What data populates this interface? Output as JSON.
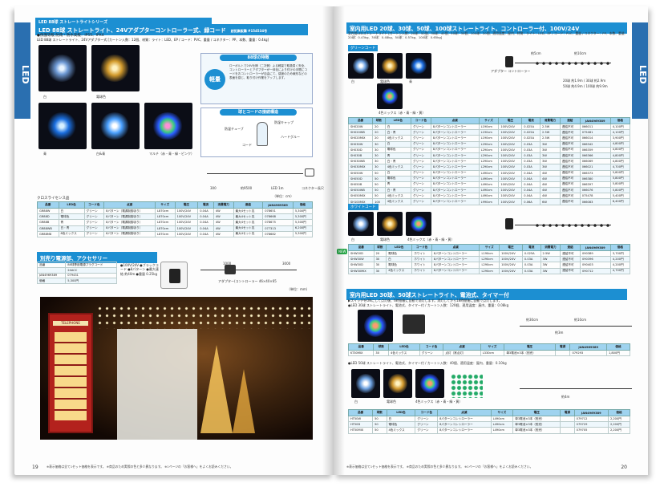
{
  "left": {
    "page_number": "19",
    "side_tab": "LED",
    "series": "LED 88球 ストレートライトシリーズ",
    "title": "LED 88球 ストレートライト、24Vアダプターコントローラー式、緑コード",
    "code_ref": "創拓集販購 #154534号",
    "spec_line": "LED 88球 ストレートライト、24Vアダプター式 [カートン入数：12個、材質：ライト：LED、EP / コード：PVC、重量 / コネクター：PP、本数、重量：0.4kg]",
    "spec_line2": "●保護等級 防雨・防水高級：IP55、IPX4",
    "photo_captions": [
      "白",
      "電球色",
      "青",
      "白&青",
      "マルチ（赤・青・緑・ピンク）"
    ],
    "feature_title": "88球の特徴",
    "feature_badge": "軽量",
    "feature_text": "ローボルトで24V仕様（二次側）よる軽量で取扱易く安全、コントローラーとアダプターが一体化により付けの手間にコードをおコントローラーが自由にて、感度のため線形などの表面を感じ、取り付け作業をアップします。",
    "diagram_title": "球とコードの接続構造",
    "diagram_labels": [
      "防湿キャップ",
      "防湿チューブ",
      "コード",
      "ハードグルー"
    ],
    "dim_labels": [
      "300",
      "約9500",
      "LED 1m",
      "コネクター長尺"
    ],
    "dim_unit": "（単位：cm）",
    "table1_title": "クロスライセンス品",
    "table1_head": [
      "品番",
      "LED色",
      "コード色",
      "点滅",
      "サイズ",
      "電圧",
      "電流",
      "消費電力",
      "連結",
      "JAN4969389",
      "価格"
    ],
    "table1_rows": [
      [
        "GR88W",
        "白",
        "グリーン",
        "8パターン（電源制御あり）",
        "L870cm",
        "100V/24V",
        "0.04A",
        "4W",
        "最大4セット迄",
        "078651",
        "5,300円"
      ],
      [
        "GR88D",
        "電球色",
        "グリーン",
        "8パターン（電源制御あり）",
        "L870cm",
        "100V/24V",
        "0.04A",
        "4W",
        "最大4セット迄",
        "078668",
        "5,300円"
      ],
      [
        "GR88B",
        "青",
        "グリーン",
        "8パターン（電源制御あり）",
        "L870cm",
        "100V/24V",
        "0.04A",
        "4W",
        "最大4セット迄",
        "078675",
        "5,300円"
      ],
      [
        "GR88WB",
        "白・青",
        "グリーン",
        "8パターン（電源制御あり）",
        "L870cm",
        "100V/24V",
        "0.04A",
        "4W",
        "最大4セット迄",
        "077313",
        "6,200円"
      ],
      [
        "GR88M8",
        "8色ミックス",
        "グリーン",
        "8パターン（電源制御あり）",
        "L870cm",
        "100V/24V",
        "0.04A",
        "4W",
        "最大4セット迄",
        "078682",
        "5,300円"
      ]
    ],
    "acc_title": "別売り電源部、アクセサリー",
    "acc_rows": [
      [
        "品番",
        "88球専用電源プラグコード"
      ],
      [
        "",
        "24ACC"
      ],
      [
        "JAN4969389",
        "079431"
      ],
      [
        "価格",
        "5,300円"
      ]
    ],
    "acc_specs": "●100V/24V ●ブラックコード ●8パターン ●最大連結 約40m ●重量 0.25kg",
    "adapter_label": "アダプター(コントローラー 46×40×65",
    "acc_unit": "（単位：mm）",
    "acc_dims": [
      "1000",
      "3000"
    ],
    "photo_label": "TELEPHONE",
    "footer": "※表示価格は全て1セット価格を表示です。 ※商品のため実際の色と多少異なります。 ※1ページの「お客様へ」をよくお読みください。"
  },
  "right": {
    "page_number": "20",
    "side_tab": "LED",
    "title": "室内用LED 20球、30球、50球、100球ストレートライト、コントローラー付、100V/24V",
    "spec_line": "室内用LEDストレートライト [カートン入数：20球：50個、30球：40個、50球：30個、100球：20個、適用温度：屋内、材質：ライト：LED、EP / コード：PVC、重量 / コネクター：PP、本数、重量：20球：0.43kg、30球：0.48kg、50球：0.57kg、100球：0.65kg]",
    "green_label": "グリーンコード",
    "white_label": "ホワイトコード",
    "controller_label": "アダプター コントローラー",
    "length_labels": [
      "約5cm",
      "約10cm"
    ],
    "len_notes": [
      "20球 約1.9m / 30球 約2.9m",
      "50球 約4.9m / 100球 約9.9m"
    ],
    "green_captions": [
      "白",
      "電球色",
      "青",
      "4色ミックス（赤・青・緑・黄）"
    ],
    "table_head": [
      "品番",
      "球数",
      "LED色",
      "コード色",
      "点滅",
      "サイズ",
      "電圧",
      "電流",
      "消費電力",
      "連結",
      "JAN4969389",
      "価格"
    ],
    "green_rows": [
      [
        "SH020W",
        "20",
        "白",
        "グリーン",
        "8パターンコントローラー",
        "L190cm",
        "100V/24V",
        "0.025A",
        "2.5W",
        "連結不可",
        "066011",
        "4,100円"
      ],
      [
        "SH020WB",
        "20",
        "白・青",
        "グリーン",
        "8パターンコントローラー",
        "L190cm",
        "100V/24V",
        "0.025A",
        "2.5W",
        "連結不可",
        "075481",
        "4,100円"
      ],
      [
        "SH020MIX",
        "20",
        "4色ミックス",
        "グリーン",
        "8パターンコントローラー",
        "L190cm",
        "100V/24V",
        "0.025A",
        "2.5W",
        "連結不可",
        "066014",
        "3,900円"
      ],
      [
        "SH030W",
        "30",
        "白",
        "グリーン",
        "8パターンコントローラー",
        "L290cm",
        "100V/24V",
        "0.03A",
        "3W",
        "連結不可",
        "066342",
        "4,800円"
      ],
      [
        "SH030D",
        "30",
        "電球色",
        "グリーン",
        "8パターンコントローラー",
        "L290cm",
        "100V/24V",
        "0.03A",
        "3W",
        "連結不可",
        "066359",
        "4,800円"
      ],
      [
        "SH030B",
        "30",
        "青",
        "グリーン",
        "8パターンコントローラー",
        "L290cm",
        "100V/24V",
        "0.03A",
        "3W",
        "連結不可",
        "066366",
        "4,800円"
      ],
      [
        "SH030WB",
        "30",
        "白・青",
        "グリーン",
        "8パターンコントローラー",
        "L290cm",
        "100V/24V",
        "0.03A",
        "3W",
        "連結不可",
        "066069",
        "4,800円"
      ],
      [
        "SH030MIX",
        "30",
        "4色ミックス",
        "グリーン",
        "8パターンコントローラー",
        "L290cm",
        "100V/24V",
        "0.03A",
        "3W",
        "連結不可",
        "066021",
        "4,700円"
      ],
      [
        "SH050W",
        "50",
        "白",
        "グリーン",
        "8パターンコントローラー",
        "L490cm",
        "100V/24V",
        "0.04A",
        "4W",
        "連結不可",
        "066373",
        "5,800円"
      ],
      [
        "SH050D",
        "50",
        "電球色",
        "グリーン",
        "8パターンコントローラー",
        "L490cm",
        "100V/24V",
        "0.04A",
        "4W",
        "連結不可",
        "066380",
        "5,800円"
      ],
      [
        "SH050B",
        "50",
        "青",
        "グリーン",
        "8パターンコントローラー",
        "L490cm",
        "100V/24V",
        "0.04A",
        "4W",
        "連結不可",
        "066397",
        "5,800円"
      ],
      [
        "SH050WB",
        "50",
        "白・青",
        "グリーン",
        "8パターンコントローラー",
        "L490cm",
        "100V/24V",
        "0.04A",
        "4W",
        "連結不可",
        "066076",
        "5,800円"
      ],
      [
        "SH050MIX",
        "50",
        "4色ミックス",
        "グリーン",
        "8パターンコントローラー",
        "L490cm",
        "100V/24V",
        "0.04A",
        "4W",
        "連結不可",
        "075478",
        "5,400円"
      ],
      [
        "SH100MIX",
        "100",
        "4色ミックス",
        "グリーン",
        "8パターンコントローラー",
        "L990cm",
        "100V/24V",
        "0.06A",
        "6W",
        "連結不可",
        "066083",
        "8,400円"
      ]
    ],
    "white_captions": [
      "白",
      "電球色",
      "4色ミックス（赤・青・緑・黄）"
    ],
    "new_badge": "NEW",
    "white_rows": [
      [
        "SHW20D",
        "20",
        "電球色",
        "ホワイト",
        "8パターンコントローラー",
        "L190cm",
        "100V/24V",
        "0.025A",
        "2.5W",
        "連結不可",
        "090389",
        "3,700円"
      ],
      [
        "SHW30W",
        "30",
        "白",
        "ホワイト",
        "8パターンコントローラー",
        "L290cm",
        "100V/24V",
        "0.03A",
        "3W",
        "連結不可",
        "090396",
        "4,200円"
      ],
      [
        "SHW30D",
        "30",
        "電球色",
        "ホワイト",
        "8パターンコントローラー",
        "L290cm",
        "100V/24V",
        "0.03A",
        "3W",
        "連結不可",
        "090403",
        "4,200円"
      ],
      [
        "SHW30MIX",
        "30",
        "4色ミックス",
        "ホワイト",
        "8パターンコントローラー",
        "L290cm",
        "100V/24V",
        "0.03A",
        "3W",
        "連結不可",
        "090712",
        "4,700円"
      ]
    ],
    "title2": "室内用LED 30球、50球ストレートライト、電池式、タイマー付",
    "spec2a": "▶スイッチをONにして点灯後、6時間後に自動で消灯します。消灯してから18時間後に自動で点灯します。",
    "spec2b": "●LED 30球 ストレートライト、電池式、タイマー付 / カートン入数：120個、適用温度：屋内、重量：0.08kg",
    "spec2c": "●LED 50球 ストレートライト、電池式、タイマー付 / カートン入数：40個、適用温度：屋内、重量：0.10kg",
    "battery_labels": [
      "約30cm",
      "約10cm",
      "約3m",
      "約4m"
    ],
    "t2_head": [
      "品番",
      "球数",
      "LED色",
      "コード色",
      "点滅",
      "サイズ",
      "電圧",
      "電源",
      "JAN4969389",
      "価格"
    ],
    "t2_rows": [
      [
        "KT30MIX",
        "30",
        "4色ミックス",
        "グリーン",
        "点灯（常点灯）",
        "L330cm",
        "単3電池×3本（別売）",
        "",
        "079293",
        "1,800円"
      ]
    ],
    "t3_rows": [
      [
        "HT50W",
        "50",
        "白",
        "グリーン",
        "8パターンコントローラー",
        "L490cm",
        "単3電池×3本（別売）",
        "",
        "079712",
        "2,200円"
      ],
      [
        "HT50D",
        "50",
        "電球色",
        "グリーン",
        "8パターンコントローラー",
        "L490cm",
        "単3電池×3本（別売）",
        "",
        "079729",
        "2,200円"
      ],
      [
        "HT50MIX",
        "50",
        "4色ミックス",
        "グリーン",
        "8パターンコントローラー",
        "L490cm",
        "単3電池×3本（別売）",
        "",
        "079705",
        "2,200円"
      ]
    ],
    "bottom_captions": [
      "白",
      "電球色",
      "4色ミックス（赤・青・緑・黄）"
    ],
    "footer": "※表示価格は全て1セット価格を表示です。 ※商品のため実際の色と多少異なります。 ※1ページの「お客様へ」をよくお読みください。"
  },
  "colors": {
    "accent": "#1c8fd2",
    "tab": "#2a6fb0",
    "header_row": "#9fd3ef"
  }
}
